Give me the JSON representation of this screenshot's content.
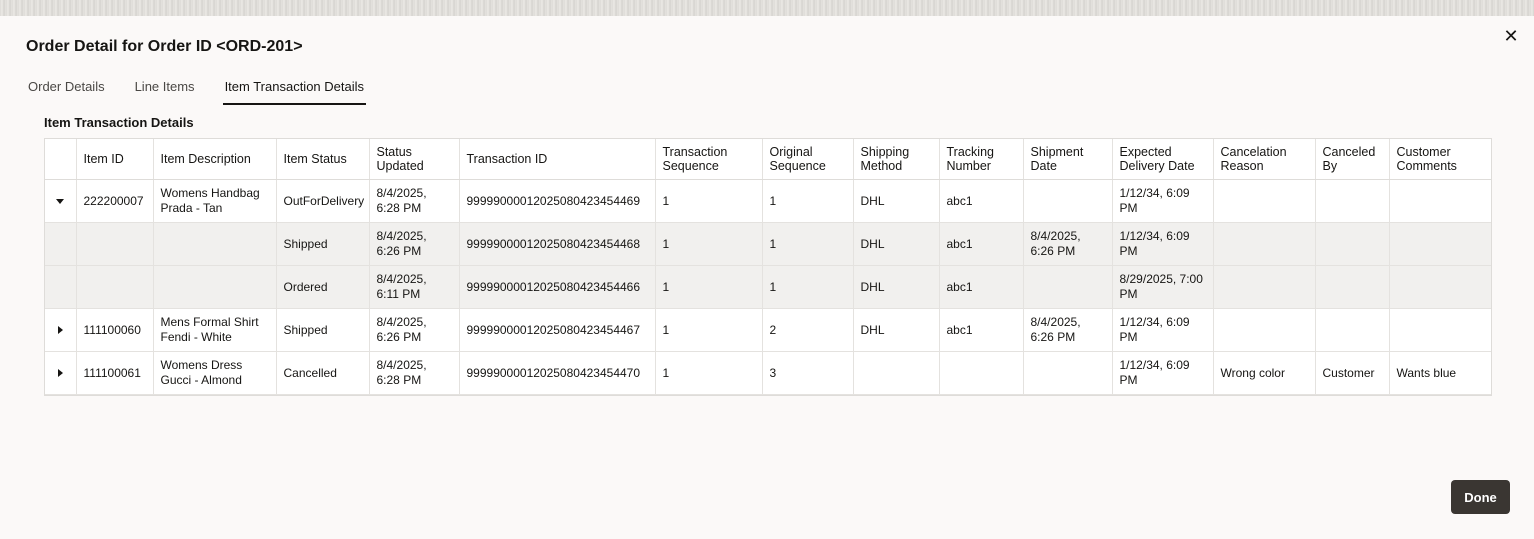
{
  "dialog": {
    "title": "Order Detail for Order ID <ORD-201>",
    "close_icon": "close-icon",
    "close_glyph": "✕",
    "done_label": "Done"
  },
  "tabs": [
    {
      "label": "Order Details",
      "active": false
    },
    {
      "label": "Line Items",
      "active": false
    },
    {
      "label": "Item Transaction Details",
      "active": true
    }
  ],
  "section": {
    "title": "Item Transaction Details"
  },
  "table": {
    "headers": [
      "",
      "Item ID",
      "Item Description",
      "Item Status",
      "Status Updated",
      "Transaction ID",
      "Transaction Sequence",
      "Original Sequence",
      "Shipping Method",
      "Tracking Number",
      "Shipment Date",
      "Expected Delivery Date",
      "Cancelation Reason",
      "Canceled By",
      "Customer Comments"
    ],
    "rows": [
      {
        "type": "parent",
        "expanded": true,
        "cells": [
          "",
          "222200007",
          "Womens Handbag Prada - Tan",
          "OutForDelivery",
          "8/4/2025, 6:28 PM",
          "99999000012025080423454469",
          "1",
          "1",
          "DHL",
          "abc1",
          "",
          "1/12/34, 6:09 PM",
          "",
          "",
          ""
        ]
      },
      {
        "type": "child",
        "expanded": false,
        "cells": [
          "",
          "",
          "",
          "Shipped",
          "8/4/2025, 6:26 PM",
          "99999000012025080423454468",
          "1",
          "1",
          "DHL",
          "abc1",
          "8/4/2025, 6:26 PM",
          "1/12/34, 6:09 PM",
          "",
          "",
          ""
        ]
      },
      {
        "type": "child",
        "expanded": false,
        "cells": [
          "",
          "",
          "",
          "Ordered",
          "8/4/2025, 6:11 PM",
          "99999000012025080423454466",
          "1",
          "1",
          "DHL",
          "abc1",
          "",
          "8/29/2025, 7:00 PM",
          "",
          "",
          ""
        ]
      },
      {
        "type": "parent",
        "expanded": false,
        "cells": [
          "",
          "111100060",
          "Mens Formal Shirt Fendi - White",
          "Shipped",
          "8/4/2025, 6:26 PM",
          "99999000012025080423454467",
          "1",
          "2",
          "DHL",
          "abc1",
          "8/4/2025, 6:26 PM",
          "1/12/34, 6:09 PM",
          "",
          "",
          ""
        ]
      },
      {
        "type": "parent",
        "expanded": false,
        "cells": [
          "",
          "111100061",
          "Womens Dress Gucci - Almond",
          "Cancelled",
          "8/4/2025, 6:28 PM",
          "99999000012025080423454470",
          "1",
          "3",
          "",
          "",
          "",
          "1/12/34, 6:09 PM",
          "Wrong color",
          "Customer",
          "Wants blue"
        ]
      }
    ]
  },
  "colors": {
    "primary_button": "#3a3632",
    "child_row_bg": "#f1f0ee",
    "dialog_bg": "#fbf9f8"
  }
}
